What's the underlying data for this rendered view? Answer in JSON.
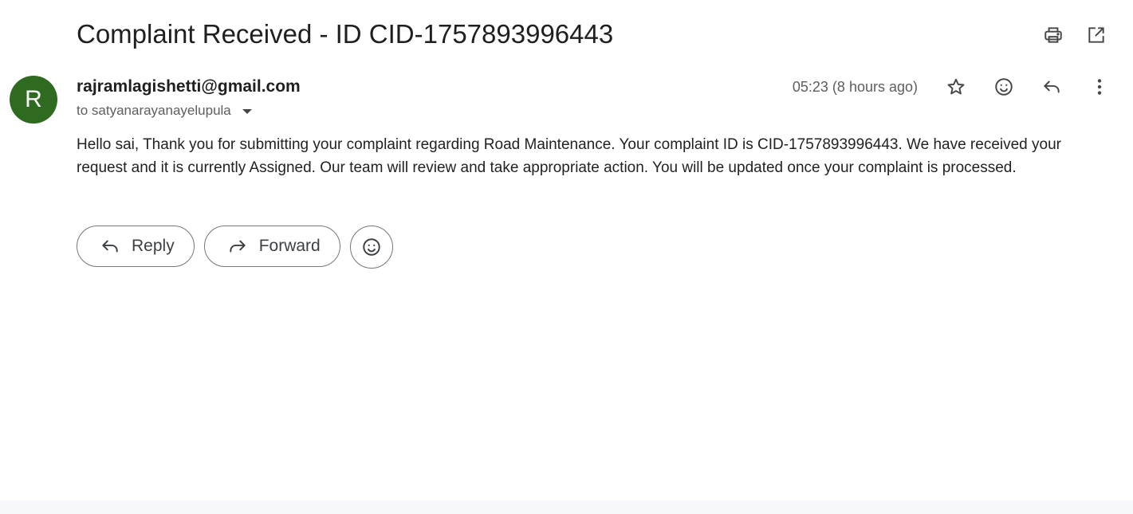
{
  "email": {
    "subject": "Complaint Received - ID CID-1757893996443",
    "sender": {
      "avatar_initial": "R",
      "avatar_color": "#2e6b21",
      "address": "rajramlagishetti@gmail.com"
    },
    "recipient_line": "to satyanarayanayelupula",
    "time": "05:23 (8 hours ago)",
    "body": "Hello sai, Thank you for submitting your complaint regarding Road Maintenance. Your complaint ID is CID-1757893996443. We have received your request and it is currently Assigned. Our team will review and take appropriate action. You will be updated once your complaint is processed."
  },
  "top_actions": {
    "icons": [
      "print-icon",
      "open-in-new-window-icon"
    ]
  },
  "message_actions": {
    "icons": [
      "star-icon",
      "emoji-reaction-icon",
      "reply-icon",
      "more-vert-icon"
    ]
  },
  "bottom_actions": {
    "reply_label": "Reply",
    "forward_label": "Forward",
    "emoji_icon": "emoji-reaction-icon"
  }
}
